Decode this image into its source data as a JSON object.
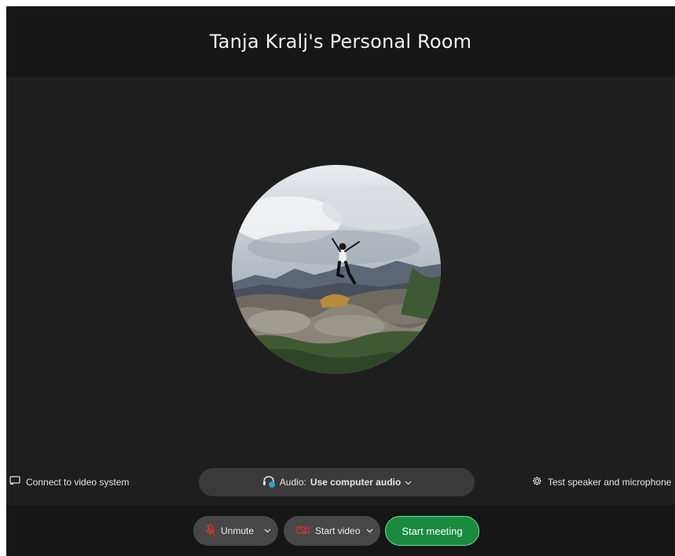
{
  "header": {
    "title": "Tanja Kralj's Personal Room"
  },
  "options": {
    "connect_video_label": "Connect to video system",
    "audio": {
      "label": "Audio:",
      "value": "Use computer audio"
    },
    "test_label": "Test speaker and microphone"
  },
  "controls": {
    "unmute_label": "Unmute",
    "start_video_label": "Start video",
    "start_meeting_label": "Start meeting"
  },
  "colors": {
    "background": "#1e1e1e",
    "header_bar": "#161616",
    "muted_icon": "#d9342b",
    "start_meeting": "#1a8a3e",
    "start_meeting_border": "#6fe09a",
    "audio_headset_accent": "#2a9fd8"
  },
  "icons": {
    "connect_video": "screen-cast-icon",
    "audio": "headset-icon",
    "test": "gear-icon",
    "unmute": "microphone-muted-icon",
    "start_video": "video-camera-muted-icon",
    "dropdown": "chevron-down-icon"
  }
}
